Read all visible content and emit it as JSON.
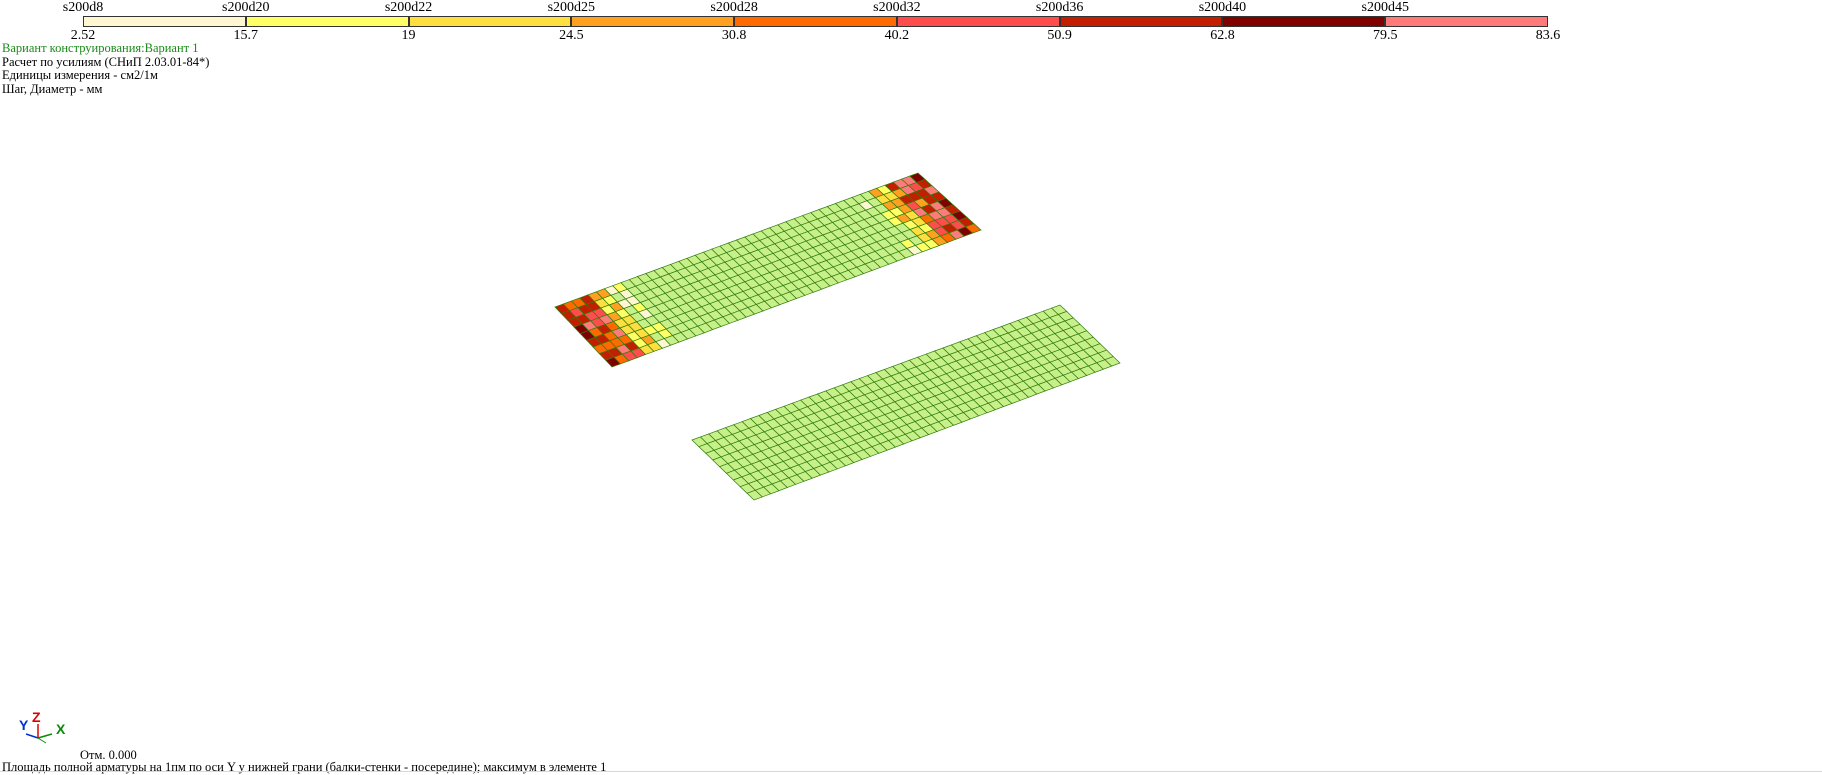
{
  "legend": {
    "top_labels": [
      "s200d8",
      "s200d20",
      "s200d22",
      "s200d25",
      "s200d28",
      "s200d32",
      "s200d36",
      "s200d40",
      "s200d45"
    ],
    "bottom_labels": [
      "2.52",
      "15.7",
      "19",
      "24.5",
      "30.8",
      "40.2",
      "50.9",
      "62.8",
      "79.5",
      "83.6"
    ],
    "colors": [
      "#fff6d2",
      "#ffff66",
      "#ffdf40",
      "#ffa020",
      "#ff6a00",
      "#ff4d4d",
      "#c41e00",
      "#800000",
      "#ff7b7b"
    ]
  },
  "info": {
    "variant": "Вариант конструирования:Вариант 1",
    "calc": "Расчет по усилиям (СНиП 2.03.01-84*)",
    "units": "Единицы измерения - см2/1м",
    "step": "Шаг, Диаметр - мм"
  },
  "axes": {
    "y": "Y",
    "z": "Z",
    "x": "X"
  },
  "elevation": "Отм. 0.000",
  "status": "Площадь полной арматуры на 1пм по оси Y у нижней грани (балки-стенки - посередине); максимум в элементе 1",
  "mesh_colors": {
    "base": "#c8f08a",
    "grid": "#2f7d0a"
  }
}
